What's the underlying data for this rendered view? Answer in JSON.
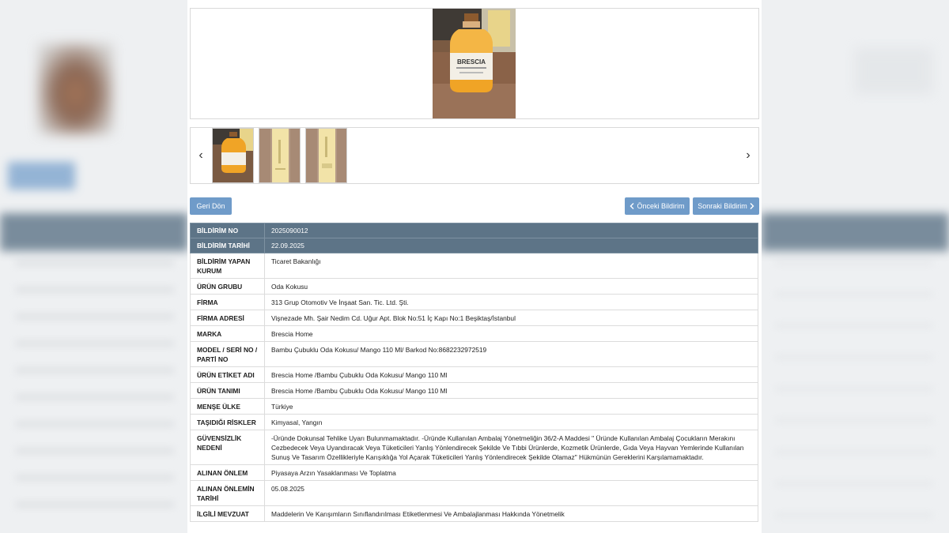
{
  "navigation": {
    "back_label": "Geri Dön",
    "prev_label": "Önceki Bildirim",
    "next_label": "Sonraki Bildirim",
    "prev_icon": "chevron-left-icon",
    "next_icon": "chevron-right-icon",
    "gallery_prev_arrow": "‹",
    "gallery_next_arrow": "›"
  },
  "product_image_label": "BRESCIA",
  "colors": {
    "button_blue": "#6f9bc9",
    "header_row": "#5d7487"
  },
  "rows": [
    {
      "label": "BİLDİRİM NO",
      "value": "2025090012"
    },
    {
      "label": "BİLDİRİM TARİHİ",
      "value": "22.09.2025"
    },
    {
      "label": "BİLDİRİM YAPAN KURUM",
      "value": "Ticaret Bakanlığı"
    },
    {
      "label": "ÜRÜN GRUBU",
      "value": "Oda Kokusu"
    },
    {
      "label": "FİRMA",
      "value": "313 Grup Otomotiv Ve İnşaat San. Tic. Ltd. Şti."
    },
    {
      "label": "FİRMA ADRESİ",
      "value": "Vişnezade Mh. Şair Nedim Cd. Uğur Apt. Blok No:51 İç Kapı No:1 Beşiktaş/İstanbul"
    },
    {
      "label": "MARKA",
      "value": "Brescia Home"
    },
    {
      "label": "MODEL / SERİ NO / PARTİ NO",
      "value": "Bambu Çubuklu Oda Kokusu/ Mango 110 Ml/ Barkod No:8682232972519"
    },
    {
      "label": "ÜRÜN ETİKET ADI",
      "value": "Brescia Home /Bambu Çubuklu Oda Kokusu/ Mango 110 Ml"
    },
    {
      "label": "ÜRÜN TANIMI",
      "value": "Brescia Home /Bambu Çubuklu Oda Kokusu/ Mango 110 Ml"
    },
    {
      "label": "MENŞE ÜLKE",
      "value": "Türkiye"
    },
    {
      "label": "TAŞIDIĞI RİSKLER",
      "value": "Kimyasal, Yangın"
    },
    {
      "label": "GÜVENSİZLİK NEDENİ",
      "value": "-Üründe Dokunsal Tehlike Uyarı Bulunmamaktadır. -Üründe Kullanılan Ambalaj Yönetmeliğin 36/2-A Maddesi \" Üründe Kullanılan Ambalaj Çocukların Merakını Cezbedecek Veya Uyandıracak Veya Tüketicileri Yanlış Yönlendirecek Şekilde Ve Tıbbi Ürünlerde, Kozmetik Ürünlerde, Gıda Veya Hayvan Yemlerinde Kullanılan Sunuş Ve Tasarım Özellikleriyle Karışıklığa Yol Açarak Tüketicileri Yanlış Yönlendirecek Şekilde Olamaz\" Hükmünün Gereklerini Karşılamamaktadır."
    },
    {
      "label": "ALINAN ÖNLEM",
      "value": "Piyasaya Arzın Yasaklanması Ve Toplatma"
    },
    {
      "label": "ALINAN ÖNLEMİN TARİHİ",
      "value": "05.08.2025"
    },
    {
      "label": "İLGİLİ MEVZUAT",
      "value": "Maddelerin Ve Karışımların Sınıflandırılması Etiketlenmesi Ve Ambalajlanması Hakkında Yönetmelik"
    }
  ]
}
